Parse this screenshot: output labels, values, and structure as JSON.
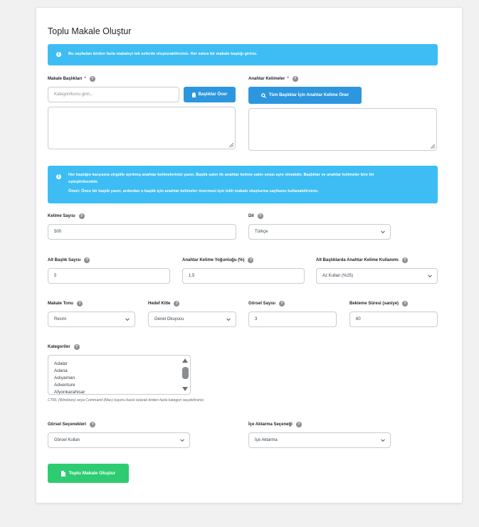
{
  "page_title": "Toplu Makale Oluştur",
  "info_alert": "Bu sayfadan birden fazla makaleyi tek seferde oluşturabilirsiniz. Her satıra bir makale başlığı giriniz.",
  "titles": {
    "label": "Makale Başlıkları",
    "required": "*",
    "input_placeholder": "Kategori/konu girin...",
    "suggest_button": "Başlıklar Öner",
    "textarea_value": ""
  },
  "keywords": {
    "label": "Anahtar Kelimeler",
    "required": "*",
    "suggest_all_button": "Tüm Başlıklar İçin Anahtar Kelime Öner",
    "textarea_value": ""
  },
  "keyword_alert": {
    "line1": "Her başlığın karşısına virgülle ayrılmış anahtar kelimelerinizi yazın. Başlık satırı ile anahtar kelime satırı sırası aynı olmalıdır. Başlıklar ve anahtar kelimeler bire bir",
    "line2": "eşleştirilecektir.",
    "line3": "Öneri: Önce bir başlık yazın, ardından o başlık için anahtar kelimeler önermesi için tekli makale oluşturma sayfasını kullanabilirsiniz."
  },
  "word_count": {
    "label": "Kelime Sayısı",
    "value": "500"
  },
  "language": {
    "label": "Dil",
    "value": "Türkçe"
  },
  "subheading_count": {
    "label": "Alt Başlık Sayısı",
    "value": "5"
  },
  "keyword_density": {
    "label": "Anahtar Kelime Yoğunluğu (%)",
    "value": "1,5"
  },
  "subheading_keyword_usage": {
    "label": "Alt Başlıklarda Anahtar Kelime Kullanımı",
    "value": "Az Kullan (%25)"
  },
  "tone": {
    "label": "Makale Tonu",
    "value": "Resmi"
  },
  "audience": {
    "label": "Hedef Kitle",
    "value": "Genel Okuyucu"
  },
  "image_count": {
    "label": "Görsel Sayısı",
    "value": "3"
  },
  "wait_time": {
    "label": "Bekleme Süresi (saniye)",
    "value": "60"
  },
  "categories": {
    "label": "Kategoriler",
    "options": [
      "Adalar",
      "Adana",
      "Adıyaman",
      "Adventure",
      "Afyonkarahisar"
    ],
    "note": "CTRL (Windows) veya Command (Mac) tuşunu basılı tutarak birden fazla kategori seçebilirsiniz."
  },
  "image_options": {
    "label": "Görsel Seçenekleri",
    "value": "Görsel Kullan"
  },
  "import_option": {
    "label": "İçe Aktarma Seçeneği",
    "value": "İçe Aktarma"
  },
  "submit_button": "Toplu Makale Oluştur",
  "help_glyph": "?",
  "info_glyph": "i"
}
